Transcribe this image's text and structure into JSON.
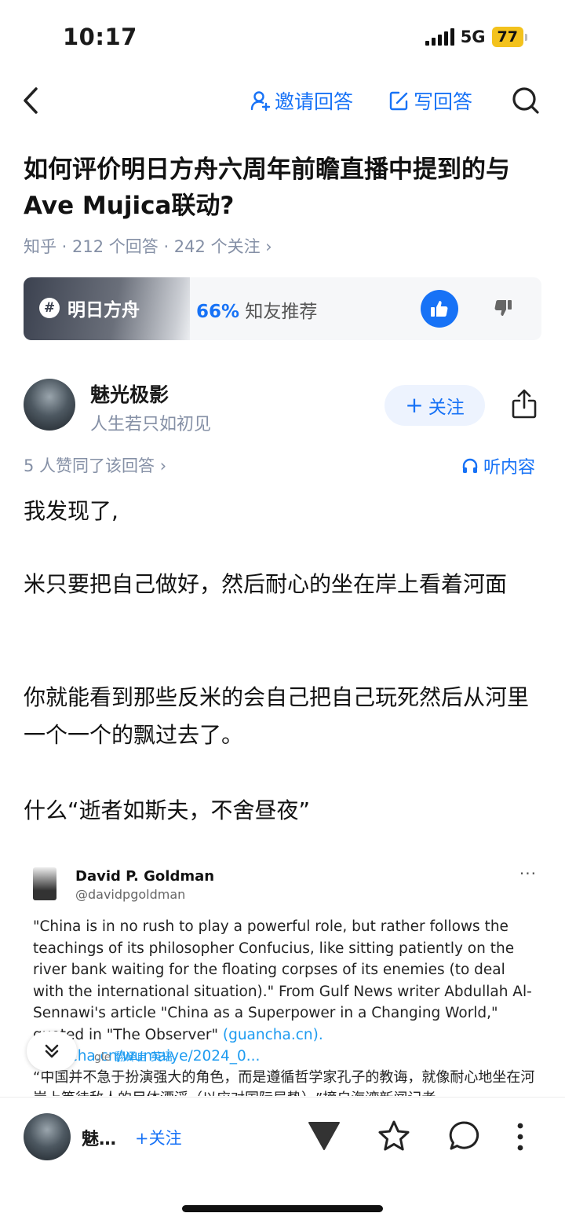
{
  "status_bar": {
    "time": "10:17",
    "network": "5G",
    "battery": "77"
  },
  "nav": {
    "invite_label": "邀请回答",
    "write_label": "写回答",
    "icons": [
      "back-icon",
      "invite-user-icon",
      "edit-icon",
      "search-icon"
    ]
  },
  "question": {
    "title": "如何评价明日方舟六周年前瞻直播中提到的与 Ave Mujica联动?",
    "meta": "知乎 · 212 个回答 · 242 个关注 ›"
  },
  "topic": {
    "name": "明日方舟",
    "recommend_percent": "66%",
    "recommend_label": "知友推荐"
  },
  "author": {
    "name": "魅光极影",
    "bio": "人生若只如初见",
    "follow_label": "关注"
  },
  "answer": {
    "agree_text": "5 人赞同了该回答 ›",
    "listen_label": "听内容",
    "paragraphs": [
      "我发现了,",
      "米只要把自己做好，然后耐心的坐在岸上看着河面",
      "你就能看到那些反米的会自己把自己玩死然后从河里一个一个的飘过去了。",
      "什么“逝者如斯夫，不舍昼夜”"
    ]
  },
  "tweet": {
    "author": "David P. Goldman",
    "handle": "@davidpgoldman",
    "more": "···",
    "text_en": "\"China is in no rush to play a powerful role, but rather follows the teachings of its philosopher Confucius, like sitting patiently on the river bank waiting for the floating corpses of its enemies (to deal with the international situation).\" From Gulf News writer Abdullah Al-Sennawi's article \"China as a Superpower in a Changing World,\" quoted in \"The Observer\"",
    "link1": "(guancha.cn).",
    "link2": "guancha.cn/wumaiye/2024_0...",
    "translate_source": "gle",
    "translate_label": "翻译自 英语",
    "text_cn": "“中国并不急于扮演强大的角色，而是遵循哲学家孔子的教诲，就像耐心地坐在河岸上等待敌人的尸体漂浮（以应对国际局势）。”摘自海湾新闻记者"
  },
  "bottom_bar": {
    "author_short": "魅…",
    "follow_label": "+关注"
  },
  "colors": {
    "accent": "#1772f6",
    "meta_gray": "#8590a6",
    "battery": "#f3c21c"
  }
}
